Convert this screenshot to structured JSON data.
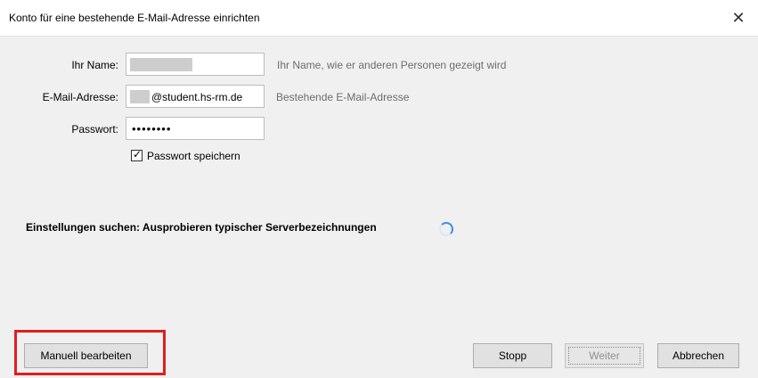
{
  "dialog": {
    "title": "Konto für eine bestehende E-Mail-Adresse einrichten",
    "close_symbol": "✕"
  },
  "form": {
    "name": {
      "label": "Ihr Name:",
      "hint": "Ihr Name, wie er anderen Personen gezeigt wird"
    },
    "email": {
      "label": "E-Mail-Adresse:",
      "value_suffix": "@student.hs-rm.de",
      "hint": "Bestehende E-Mail-Adresse"
    },
    "password": {
      "label": "Passwort:",
      "value": "••••••••"
    },
    "save_password": {
      "label": "Passwort speichern",
      "checked": true,
      "check_symbol": "✓"
    }
  },
  "status": {
    "text": "Einstellungen suchen: Ausprobieren typischer Serverbezeichnungen",
    "icon": "spinner-icon"
  },
  "buttons": {
    "manual": "Manuell bearbeiten",
    "stop": "Stopp",
    "next": "Weiter",
    "cancel": "Abbrechen"
  },
  "colors": {
    "highlight": "#e01e1e",
    "spinner": "#3b8ee8"
  }
}
